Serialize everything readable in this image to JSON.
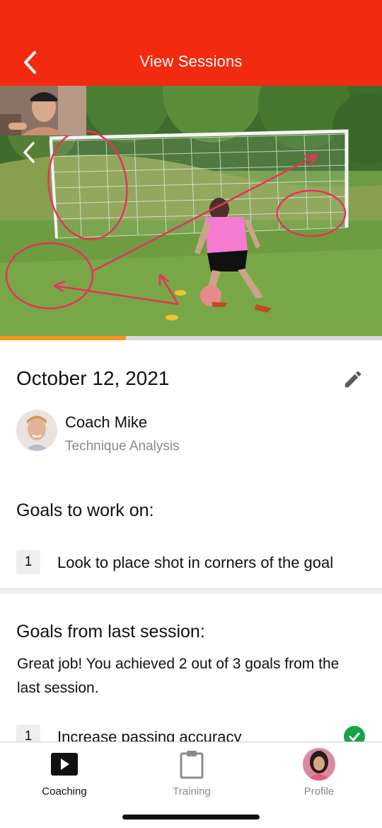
{
  "header": {
    "title": "View Sessions",
    "back_icon": "chevron-left-icon",
    "color": "#f22a10"
  },
  "video": {
    "progress": 0.33,
    "progress_color": "#f7941d",
    "annotation_color": "#e8335a"
  },
  "session": {
    "date": "October 12, 2021",
    "edit_icon": "pencil-icon",
    "coach": {
      "name": "Coach Mike",
      "subtitle": "Technique Analysis"
    }
  },
  "goals": {
    "title": "Goals to work on:",
    "items": [
      {
        "number": "1",
        "text": "Look to place shot in corners of the goal"
      }
    ]
  },
  "last_session": {
    "title": "Goals from last session:",
    "summary": "Great job! You achieved 2 out of 3 goals from the last session.",
    "items": [
      {
        "number": "1",
        "text": "Increase passing accuracy",
        "achieved": true
      }
    ]
  },
  "tabbar": {
    "tabs": [
      {
        "label": "Coaching",
        "icon": "play-icon",
        "active": true
      },
      {
        "label": "Training",
        "icon": "clipboard-icon",
        "active": false
      },
      {
        "label": "Profile",
        "icon": "avatar",
        "active": false
      }
    ]
  }
}
